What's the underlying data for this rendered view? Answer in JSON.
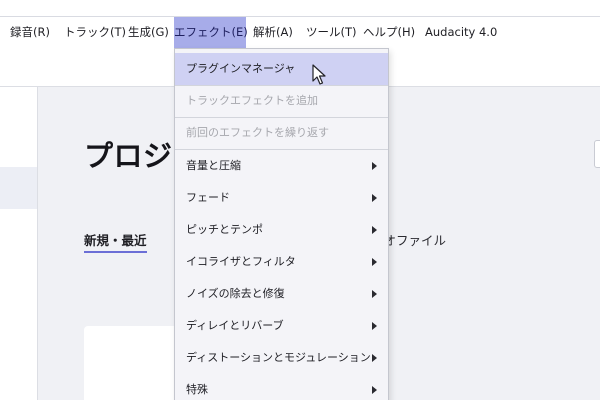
{
  "menubar": {
    "items": [
      {
        "label": "録音(R)"
      },
      {
        "label": "トラック(T)"
      },
      {
        "label": "生成(G)"
      },
      {
        "label": "エフェクト(E)"
      },
      {
        "label": "解析(A)"
      },
      {
        "label": "ツール(T)"
      },
      {
        "label": "ヘルプ(H)"
      }
    ],
    "app_label": "Audacity 4.0",
    "active_color": "#a7ace9"
  },
  "effect_menu": {
    "items": [
      {
        "label": "プラグインマネージャ",
        "enabled": true,
        "hovered": true
      },
      {
        "label": "トラックエフェクトを追加",
        "enabled": false
      },
      {
        "label": "前回のエフェクトを繰り返す",
        "enabled": false
      },
      {
        "label": "音量と圧縮",
        "enabled": true,
        "submenu": true
      },
      {
        "label": "フェード",
        "enabled": true,
        "submenu": true
      },
      {
        "label": "ピッチとテンポ",
        "enabled": true,
        "submenu": true
      },
      {
        "label": "イコライザとフィルタ",
        "enabled": true,
        "submenu": true
      },
      {
        "label": "ノイズの除去と修復",
        "enabled": true,
        "submenu": true
      },
      {
        "label": "ディレイとリバーブ",
        "enabled": true,
        "submenu": true
      },
      {
        "label": "ディストーションとモジュレーション",
        "enabled": true,
        "submenu": true
      },
      {
        "label": "特殊",
        "enabled": true,
        "submenu": true
      }
    ],
    "hover_color": "#cfd1f3"
  },
  "main": {
    "heading": "プロジェ",
    "tabs": [
      {
        "label": "新規・最近",
        "selected": true
      },
      {
        "label": "ィオファイル",
        "selected": false
      }
    ],
    "accent_color": "#6b6fd6"
  }
}
